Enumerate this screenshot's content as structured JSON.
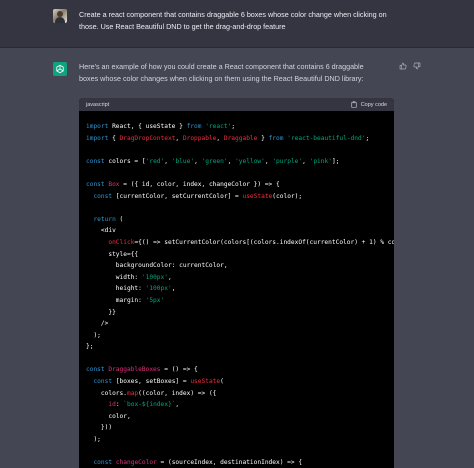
{
  "user_message": {
    "avatar": "user-avatar-photo",
    "text": "Create a react component that contains draggable 6 boxes whose color change when clicking on those. Use React Beautiful DND to get the drag-and-drop feature"
  },
  "assistant_message": {
    "avatar": "openai-logo-icon",
    "text": "Here's an example of how you could create a React component that contains 6 draggable boxes whose color changes when clicking on them using the React Beautiful DND library:",
    "feedback": {
      "thumbs_up": "thumbs-up-icon",
      "thumbs_down": "thumbs-down-icon"
    }
  },
  "code_block": {
    "language": "javascript",
    "copy_label": "Copy code",
    "lines": [
      [
        [
          "kw",
          "import "
        ],
        [
          "pl",
          "React, { useState } "
        ],
        [
          "kw",
          "from "
        ],
        [
          "str",
          "'react'"
        ],
        [
          "pl",
          ";"
        ]
      ],
      [
        [
          "kw",
          "import "
        ],
        [
          "pl",
          "{ "
        ],
        [
          "fn",
          "DragDropContext"
        ],
        [
          "pl",
          ", "
        ],
        [
          "fn",
          "Droppable"
        ],
        [
          "pl",
          ", "
        ],
        [
          "fn",
          "Draggable"
        ],
        [
          "pl",
          " } "
        ],
        [
          "kw",
          "from "
        ],
        [
          "str",
          "'react-beautiful-dnd'"
        ],
        [
          "pl",
          ";"
        ]
      ],
      [],
      [
        [
          "kw",
          "const "
        ],
        [
          "pl",
          "colors = ["
        ],
        [
          "str",
          "'red'"
        ],
        [
          "pl",
          ", "
        ],
        [
          "str",
          "'blue'"
        ],
        [
          "pl",
          ", "
        ],
        [
          "str",
          "'green'"
        ],
        [
          "pl",
          ", "
        ],
        [
          "str",
          "'yellow'"
        ],
        [
          "pl",
          ", "
        ],
        [
          "str",
          "'purple'"
        ],
        [
          "pl",
          ", "
        ],
        [
          "str",
          "'pink'"
        ],
        [
          "pl",
          "];"
        ]
      ],
      [],
      [
        [
          "kw",
          "const "
        ],
        [
          "id",
          "Box"
        ],
        [
          "pl",
          " = ({ id, color, index, changeColor }) => {"
        ]
      ],
      [
        [
          "pl",
          "  "
        ],
        [
          "kw",
          "const "
        ],
        [
          "pl",
          "[currentColor, setCurrentColor] = "
        ],
        [
          "fn",
          "useState"
        ],
        [
          "pl",
          "(color);"
        ]
      ],
      [],
      [
        [
          "pl",
          "  "
        ],
        [
          "kw",
          "return "
        ],
        [
          "pl",
          "("
        ]
      ],
      [
        [
          "pl",
          "    <div"
        ]
      ],
      [
        [
          "pl",
          "      "
        ],
        [
          "fn",
          "onClick"
        ],
        [
          "pl",
          "={() => "
        ],
        [
          "pl",
          "setCurrentColor(colors[(colors.indexOf(currentColor) + 1) % colors.length])}"
        ]
      ],
      [
        [
          "pl",
          "      style={{"
        ]
      ],
      [
        [
          "pl",
          "        backgroundColor: currentColor,"
        ]
      ],
      [
        [
          "pl",
          "        width: "
        ],
        [
          "str",
          "'100px'"
        ],
        [
          "pl",
          ","
        ]
      ],
      [
        [
          "pl",
          "        height: "
        ],
        [
          "str",
          "'100px'"
        ],
        [
          "pl",
          ","
        ]
      ],
      [
        [
          "pl",
          "        margin: "
        ],
        [
          "str",
          "'5px'"
        ]
      ],
      [
        [
          "pl",
          "      }}"
        ]
      ],
      [
        [
          "pl",
          "    />"
        ]
      ],
      [
        [
          "pl",
          "  );"
        ]
      ],
      [
        [
          "pl",
          "};"
        ]
      ],
      [],
      [
        [
          "kw",
          "const "
        ],
        [
          "id",
          "DraggableBoxes"
        ],
        [
          "pl",
          " = () => {"
        ]
      ],
      [
        [
          "pl",
          "  "
        ],
        [
          "kw",
          "const "
        ],
        [
          "pl",
          "[boxes, setBoxes] = "
        ],
        [
          "fn",
          "useState"
        ],
        [
          "pl",
          "("
        ]
      ],
      [
        [
          "pl",
          "    colors."
        ],
        [
          "fn",
          "map"
        ],
        [
          "pl",
          "((color, index) => ({"
        ]
      ],
      [
        [
          "pl",
          "      "
        ],
        [
          "id",
          "id"
        ],
        [
          "pl",
          ": "
        ],
        [
          "str",
          "`box-${index}`"
        ],
        [
          "pl",
          ","
        ]
      ],
      [
        [
          "pl",
          "      color,"
        ]
      ],
      [
        [
          "pl",
          "    }))"
        ]
      ],
      [
        [
          "pl",
          "  );"
        ]
      ],
      [],
      [
        [
          "pl",
          "  "
        ],
        [
          "kw",
          "const "
        ],
        [
          "id",
          "changeColor"
        ],
        [
          "pl",
          " = (sourceIndex, destinationIndex) => {"
        ]
      ]
    ]
  },
  "colors": {
    "page_bg": "#444654",
    "user_bg": "#343541",
    "code_bg": "#000000",
    "keyword": "#2e95d3",
    "string": "#00a67d",
    "function": "#f22c3d",
    "identifier": "#df3079",
    "accent": "#10a37f"
  }
}
